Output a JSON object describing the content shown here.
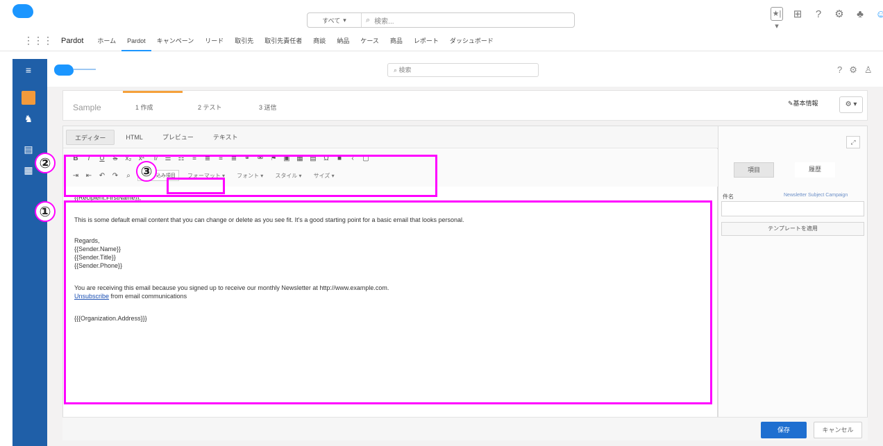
{
  "global_header": {
    "search_scope": "すべて",
    "search_placeholder": "検索..."
  },
  "nav": {
    "app_name": "Pardot",
    "items": [
      {
        "label": "ホーム"
      },
      {
        "label": "Pardot"
      },
      {
        "label": "キャンペーン"
      },
      {
        "label": "リード"
      },
      {
        "label": "取引先"
      },
      {
        "label": "取引先責任者"
      },
      {
        "label": "商談"
      },
      {
        "label": "納品"
      },
      {
        "label": "ケース"
      },
      {
        "label": "商品"
      },
      {
        "label": "レポート"
      },
      {
        "label": "ダッシュボード"
      }
    ]
  },
  "inner_header": {
    "search_placeholder": "検索"
  },
  "template": {
    "name": "Sample",
    "tabs": [
      {
        "label": "1 作成"
      },
      {
        "label": "2 テスト"
      },
      {
        "label": "3 送信"
      }
    ],
    "basic_info_label": "基本情報",
    "gear_label": "⚙ ▾"
  },
  "editor": {
    "tabs": [
      {
        "label": "エディター"
      },
      {
        "label": "HTML"
      },
      {
        "label": "プレビュー"
      },
      {
        "label": "テキスト"
      }
    ],
    "insert_merge_field_label": "差し込み項目",
    "format_dropdown": "フォーマット",
    "font_dropdown": "フォント",
    "size_dropdown": "サイズ",
    "style_dropdown": "スタイル",
    "body_lines": [
      "{{Recipient.FirstName}},",
      "This is some default email content that you can change or delete as you see fit. It's a good starting point for a basic email that looks personal.",
      "Regards,",
      "{{Sender.Name}}",
      "{{Sender.Title}}",
      "{{Sender.Phone}}",
      "You are receiving this email because you signed up to receive our monthly Newsletter at http://www.example.com.",
      "{{{Organization.Address}}}"
    ],
    "unsubscribe_link": "Unsubscribe",
    "unsubscribe_rest": " from email communications"
  },
  "side_panel": {
    "tab_a": "項目",
    "tab_b": "履歴",
    "subject_label": "件名",
    "subject_value": "Newsletter Subject Campaign",
    "apply_template_label": "テンプレートを適用"
  },
  "footer": {
    "save_label": "保存",
    "cancel_label": "キャンセル"
  },
  "annotations": {
    "one": "①",
    "two": "②",
    "three": "③"
  },
  "colors": {
    "annotation": "#ff00ff",
    "brand_blue": "#1b96ff",
    "rail_blue": "#1f5fa8",
    "save_blue": "#1f6fd0",
    "tab_accent": "#f5a13b"
  }
}
